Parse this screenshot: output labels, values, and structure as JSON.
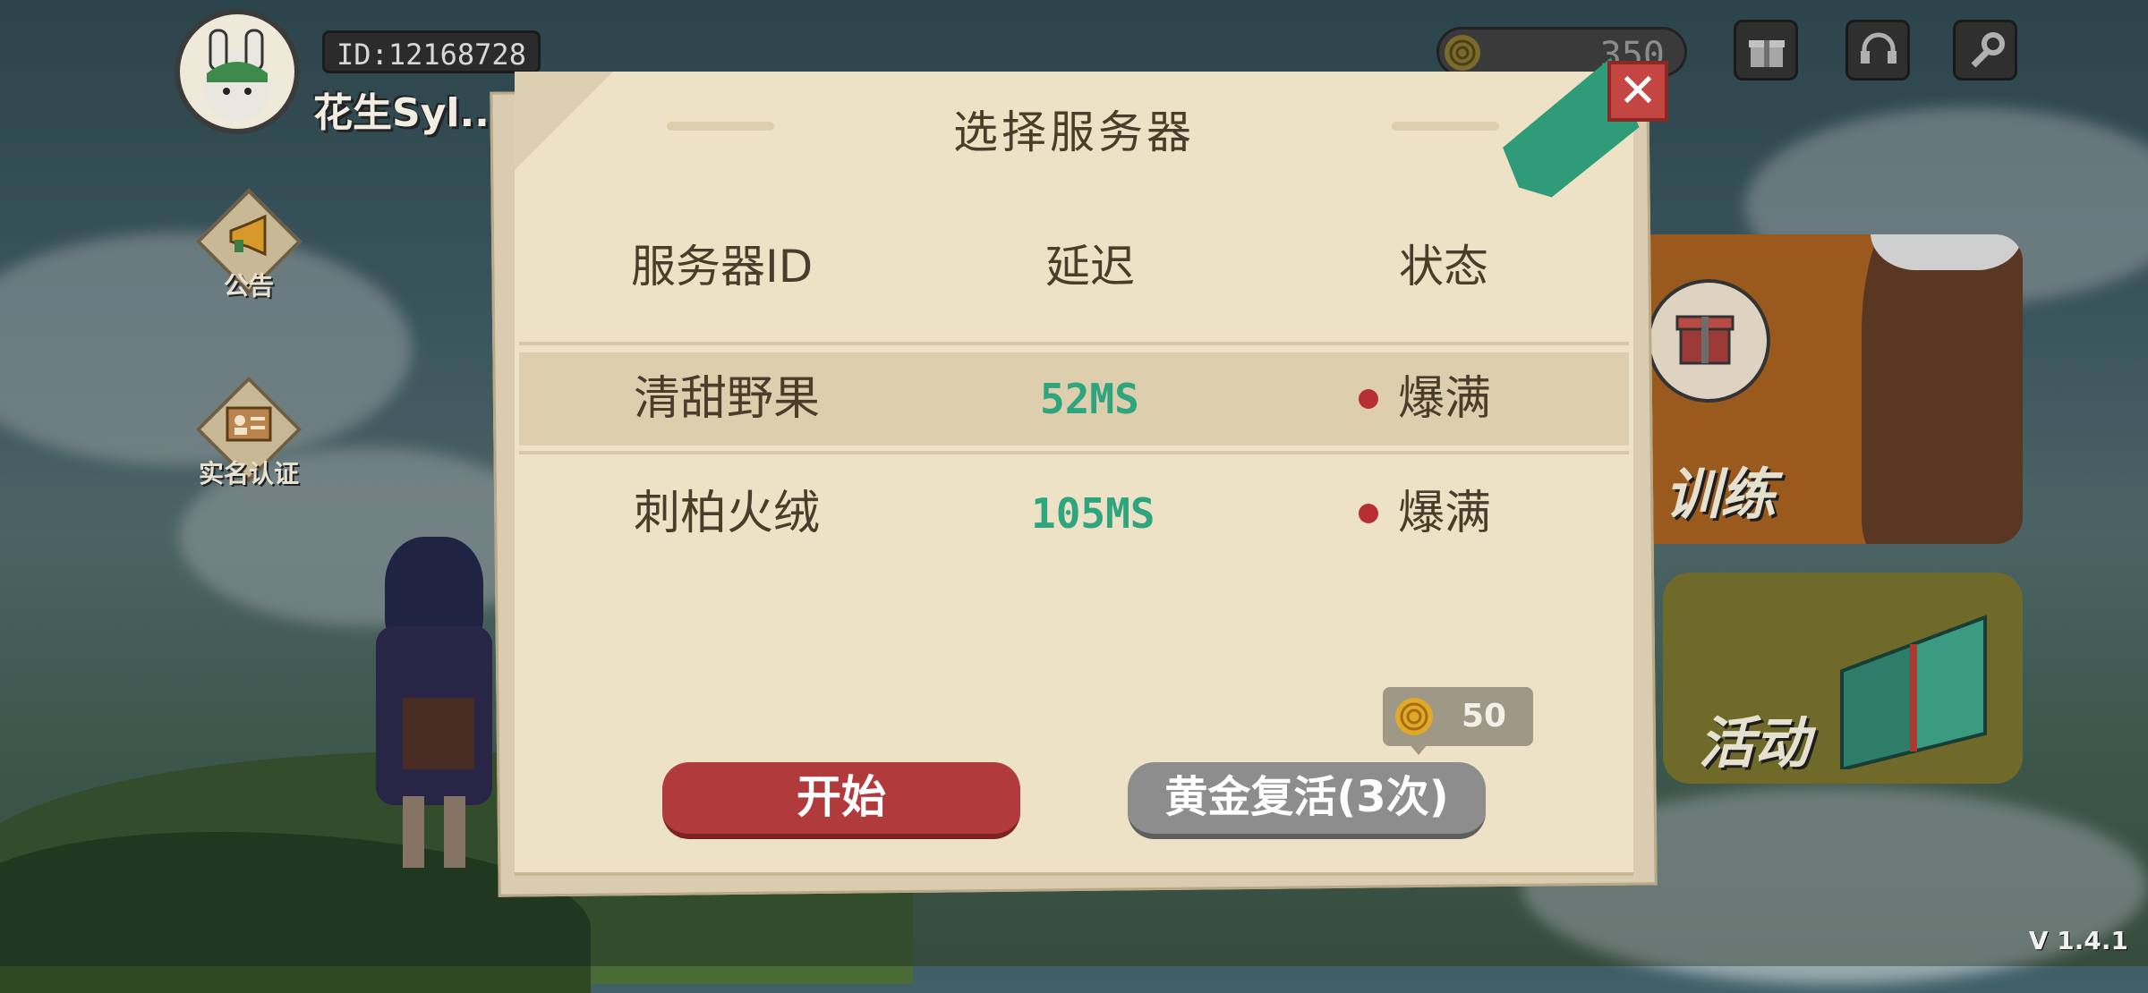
{
  "player": {
    "id_label": "ID:12168728",
    "name": "花生Syl..."
  },
  "side_menu": [
    {
      "label": "公告",
      "icon": "megaphone-icon"
    },
    {
      "label": "实名认证",
      "icon": "id-card-icon"
    }
  ],
  "top_bar": {
    "coins": "350",
    "icons": [
      "gift-icon",
      "customer-service-icon",
      "settings-wrench-icon"
    ]
  },
  "cards": {
    "training_label": "训练",
    "event_label": "活动"
  },
  "version": "V 1.4.1",
  "dialog": {
    "title": "选择服务器",
    "columns": [
      "服务器ID",
      "延迟",
      "状态"
    ],
    "rows": [
      {
        "name": "清甜野果",
        "ping": "52MS",
        "status": "爆满",
        "selected": true
      },
      {
        "name": "刺柏火绒",
        "ping": "105MS",
        "status": "爆满",
        "selected": false
      }
    ],
    "revive_cost": "50",
    "start_label": "开始",
    "revive_label": "黄金复活(3次)"
  },
  "colors": {
    "ping_green": "#2fa57f",
    "status_red": "#b72f32",
    "start_red": "#b13a3d",
    "revive_gray": "#8d8d8d"
  }
}
